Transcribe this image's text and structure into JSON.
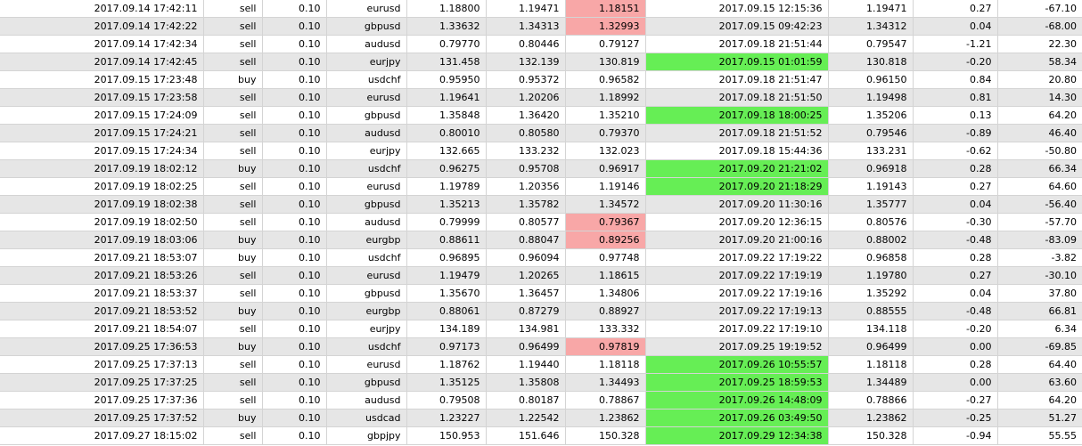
{
  "colors": {
    "row_alt": "#e6e6e6",
    "highlight_red": "#f8a7a7",
    "highlight_green": "#66ee55",
    "grid": "#d4d4d4"
  },
  "rows": [
    {
      "open_time": "2017.09.14 17:42:11",
      "type": "sell",
      "volume": "0.10",
      "symbol": "eurusd",
      "open_price": "1.18800",
      "stop_loss": "1.19471",
      "take_profit": "1.18151",
      "close_time": "2017.09.15 12:15:36",
      "close_price": "1.19471",
      "swap": "0.27",
      "profit": "-67.10",
      "highlight": "red",
      "hl_col": 6
    },
    {
      "open_time": "2017.09.14 17:42:22",
      "type": "sell",
      "volume": "0.10",
      "symbol": "gbpusd",
      "open_price": "1.33632",
      "stop_loss": "1.34313",
      "take_profit": "1.32993",
      "close_time": "2017.09.15 09:42:23",
      "close_price": "1.34312",
      "swap": "0.04",
      "profit": "-68.00",
      "highlight": "red",
      "hl_col": 6
    },
    {
      "open_time": "2017.09.14 17:42:34",
      "type": "sell",
      "volume": "0.10",
      "symbol": "audusd",
      "open_price": "0.79770",
      "stop_loss": "0.80446",
      "take_profit": "0.79127",
      "close_time": "2017.09.18 21:51:44",
      "close_price": "0.79547",
      "swap": "-1.21",
      "profit": "22.30",
      "highlight": "none",
      "hl_col": 0
    },
    {
      "open_time": "2017.09.14 17:42:45",
      "type": "sell",
      "volume": "0.10",
      "symbol": "eurjpy",
      "open_price": "131.458",
      "stop_loss": "132.139",
      "take_profit": "130.819",
      "close_time": "2017.09.15 01:01:59",
      "close_price": "130.818",
      "swap": "-0.20",
      "profit": "58.34",
      "highlight": "green",
      "hl_col": 7
    },
    {
      "open_time": "2017.09.15 17:23:48",
      "type": "buy",
      "volume": "0.10",
      "symbol": "usdchf",
      "open_price": "0.95950",
      "stop_loss": "0.95372",
      "take_profit": "0.96582",
      "close_time": "2017.09.18 21:51:47",
      "close_price": "0.96150",
      "swap": "0.84",
      "profit": "20.80",
      "highlight": "none",
      "hl_col": 0
    },
    {
      "open_time": "2017.09.15 17:23:58",
      "type": "sell",
      "volume": "0.10",
      "symbol": "eurusd",
      "open_price": "1.19641",
      "stop_loss": "1.20206",
      "take_profit": "1.18992",
      "close_time": "2017.09.18 21:51:50",
      "close_price": "1.19498",
      "swap": "0.81",
      "profit": "14.30",
      "highlight": "none",
      "hl_col": 0
    },
    {
      "open_time": "2017.09.15 17:24:09",
      "type": "sell",
      "volume": "0.10",
      "symbol": "gbpusd",
      "open_price": "1.35848",
      "stop_loss": "1.36420",
      "take_profit": "1.35210",
      "close_time": "2017.09.18 18:00:25",
      "close_price": "1.35206",
      "swap": "0.13",
      "profit": "64.20",
      "highlight": "green",
      "hl_col": 7
    },
    {
      "open_time": "2017.09.15 17:24:21",
      "type": "sell",
      "volume": "0.10",
      "symbol": "audusd",
      "open_price": "0.80010",
      "stop_loss": "0.80580",
      "take_profit": "0.79370",
      "close_time": "2017.09.18 21:51:52",
      "close_price": "0.79546",
      "swap": "-0.89",
      "profit": "46.40",
      "highlight": "none",
      "hl_col": 0
    },
    {
      "open_time": "2017.09.15 17:24:34",
      "type": "sell",
      "volume": "0.10",
      "symbol": "eurjpy",
      "open_price": "132.665",
      "stop_loss": "133.232",
      "take_profit": "132.023",
      "close_time": "2017.09.18 15:44:36",
      "close_price": "133.231",
      "swap": "-0.62",
      "profit": "-50.80",
      "highlight": "none",
      "hl_col": 0
    },
    {
      "open_time": "2017.09.19 18:02:12",
      "type": "buy",
      "volume": "0.10",
      "symbol": "usdchf",
      "open_price": "0.96275",
      "stop_loss": "0.95708",
      "take_profit": "0.96917",
      "close_time": "2017.09.20 21:21:02",
      "close_price": "0.96918",
      "swap": "0.28",
      "profit": "66.34",
      "highlight": "green",
      "hl_col": 7
    },
    {
      "open_time": "2017.09.19 18:02:25",
      "type": "sell",
      "volume": "0.10",
      "symbol": "eurusd",
      "open_price": "1.19789",
      "stop_loss": "1.20356",
      "take_profit": "1.19146",
      "close_time": "2017.09.20 21:18:29",
      "close_price": "1.19143",
      "swap": "0.27",
      "profit": "64.60",
      "highlight": "green",
      "hl_col": 7
    },
    {
      "open_time": "2017.09.19 18:02:38",
      "type": "sell",
      "volume": "0.10",
      "symbol": "gbpusd",
      "open_price": "1.35213",
      "stop_loss": "1.35782",
      "take_profit": "1.34572",
      "close_time": "2017.09.20 11:30:16",
      "close_price": "1.35777",
      "swap": "0.04",
      "profit": "-56.40",
      "highlight": "none",
      "hl_col": 0
    },
    {
      "open_time": "2017.09.19 18:02:50",
      "type": "sell",
      "volume": "0.10",
      "symbol": "audusd",
      "open_price": "0.79999",
      "stop_loss": "0.80577",
      "take_profit": "0.79367",
      "close_time": "2017.09.20 12:36:15",
      "close_price": "0.80576",
      "swap": "-0.30",
      "profit": "-57.70",
      "highlight": "red",
      "hl_col": 6
    },
    {
      "open_time": "2017.09.19 18:03:06",
      "type": "buy",
      "volume": "0.10",
      "symbol": "eurgbp",
      "open_price": "0.88611",
      "stop_loss": "0.88047",
      "take_profit": "0.89256",
      "close_time": "2017.09.20 21:00:16",
      "close_price": "0.88002",
      "swap": "-0.48",
      "profit": "-83.09",
      "highlight": "red",
      "hl_col": 6
    },
    {
      "open_time": "2017.09.21 18:53:07",
      "type": "buy",
      "volume": "0.10",
      "symbol": "usdchf",
      "open_price": "0.96895",
      "stop_loss": "0.96094",
      "take_profit": "0.97748",
      "close_time": "2017.09.22 17:19:22",
      "close_price": "0.96858",
      "swap": "0.28",
      "profit": "-3.82",
      "highlight": "none",
      "hl_col": 0
    },
    {
      "open_time": "2017.09.21 18:53:26",
      "type": "sell",
      "volume": "0.10",
      "symbol": "eurusd",
      "open_price": "1.19479",
      "stop_loss": "1.20265",
      "take_profit": "1.18615",
      "close_time": "2017.09.22 17:19:19",
      "close_price": "1.19780",
      "swap": "0.27",
      "profit": "-30.10",
      "highlight": "none",
      "hl_col": 0
    },
    {
      "open_time": "2017.09.21 18:53:37",
      "type": "sell",
      "volume": "0.10",
      "symbol": "gbpusd",
      "open_price": "1.35670",
      "stop_loss": "1.36457",
      "take_profit": "1.34806",
      "close_time": "2017.09.22 17:19:16",
      "close_price": "1.35292",
      "swap": "0.04",
      "profit": "37.80",
      "highlight": "none",
      "hl_col": 0
    },
    {
      "open_time": "2017.09.21 18:53:52",
      "type": "buy",
      "volume": "0.10",
      "symbol": "eurgbp",
      "open_price": "0.88061",
      "stop_loss": "0.87279",
      "take_profit": "0.88927",
      "close_time": "2017.09.22 17:19:13",
      "close_price": "0.88555",
      "swap": "-0.48",
      "profit": "66.81",
      "highlight": "none",
      "hl_col": 0
    },
    {
      "open_time": "2017.09.21 18:54:07",
      "type": "sell",
      "volume": "0.10",
      "symbol": "eurjpy",
      "open_price": "134.189",
      "stop_loss": "134.981",
      "take_profit": "133.332",
      "close_time": "2017.09.22 17:19:10",
      "close_price": "134.118",
      "swap": "-0.20",
      "profit": "6.34",
      "highlight": "none",
      "hl_col": 0
    },
    {
      "open_time": "2017.09.25 17:36:53",
      "type": "buy",
      "volume": "0.10",
      "symbol": "usdchf",
      "open_price": "0.97173",
      "stop_loss": "0.96499",
      "take_profit": "0.97819",
      "close_time": "2017.09.25 19:19:52",
      "close_price": "0.96499",
      "swap": "0.00",
      "profit": "-69.85",
      "highlight": "red",
      "hl_col": 6
    },
    {
      "open_time": "2017.09.25 17:37:13",
      "type": "sell",
      "volume": "0.10",
      "symbol": "eurusd",
      "open_price": "1.18762",
      "stop_loss": "1.19440",
      "take_profit": "1.18118",
      "close_time": "2017.09.26 10:55:57",
      "close_price": "1.18118",
      "swap": "0.28",
      "profit": "64.40",
      "highlight": "green",
      "hl_col": 7
    },
    {
      "open_time": "2017.09.25 17:37:25",
      "type": "sell",
      "volume": "0.10",
      "symbol": "gbpusd",
      "open_price": "1.35125",
      "stop_loss": "1.35808",
      "take_profit": "1.34493",
      "close_time": "2017.09.25 18:59:53",
      "close_price": "1.34489",
      "swap": "0.00",
      "profit": "63.60",
      "highlight": "green",
      "hl_col": 7
    },
    {
      "open_time": "2017.09.25 17:37:36",
      "type": "sell",
      "volume": "0.10",
      "symbol": "audusd",
      "open_price": "0.79508",
      "stop_loss": "0.80187",
      "take_profit": "0.78867",
      "close_time": "2017.09.26 14:48:09",
      "close_price": "0.78866",
      "swap": "-0.27",
      "profit": "64.20",
      "highlight": "green",
      "hl_col": 7
    },
    {
      "open_time": "2017.09.25 17:37:52",
      "type": "buy",
      "volume": "0.10",
      "symbol": "usdcad",
      "open_price": "1.23227",
      "stop_loss": "1.22542",
      "take_profit": "1.23862",
      "close_time": "2017.09.26 03:49:50",
      "close_price": "1.23862",
      "swap": "-0.25",
      "profit": "51.27",
      "highlight": "green",
      "hl_col": 7
    },
    {
      "open_time": "2017.09.27 18:15:02",
      "type": "sell",
      "volume": "0.10",
      "symbol": "gbpjpy",
      "open_price": "150.953",
      "stop_loss": "151.646",
      "take_profit": "150.328",
      "close_time": "2017.09.29 12:34:38",
      "close_price": "150.328",
      "swap": "-0.94",
      "profit": "55.55",
      "highlight": "green",
      "hl_col": 7
    }
  ]
}
